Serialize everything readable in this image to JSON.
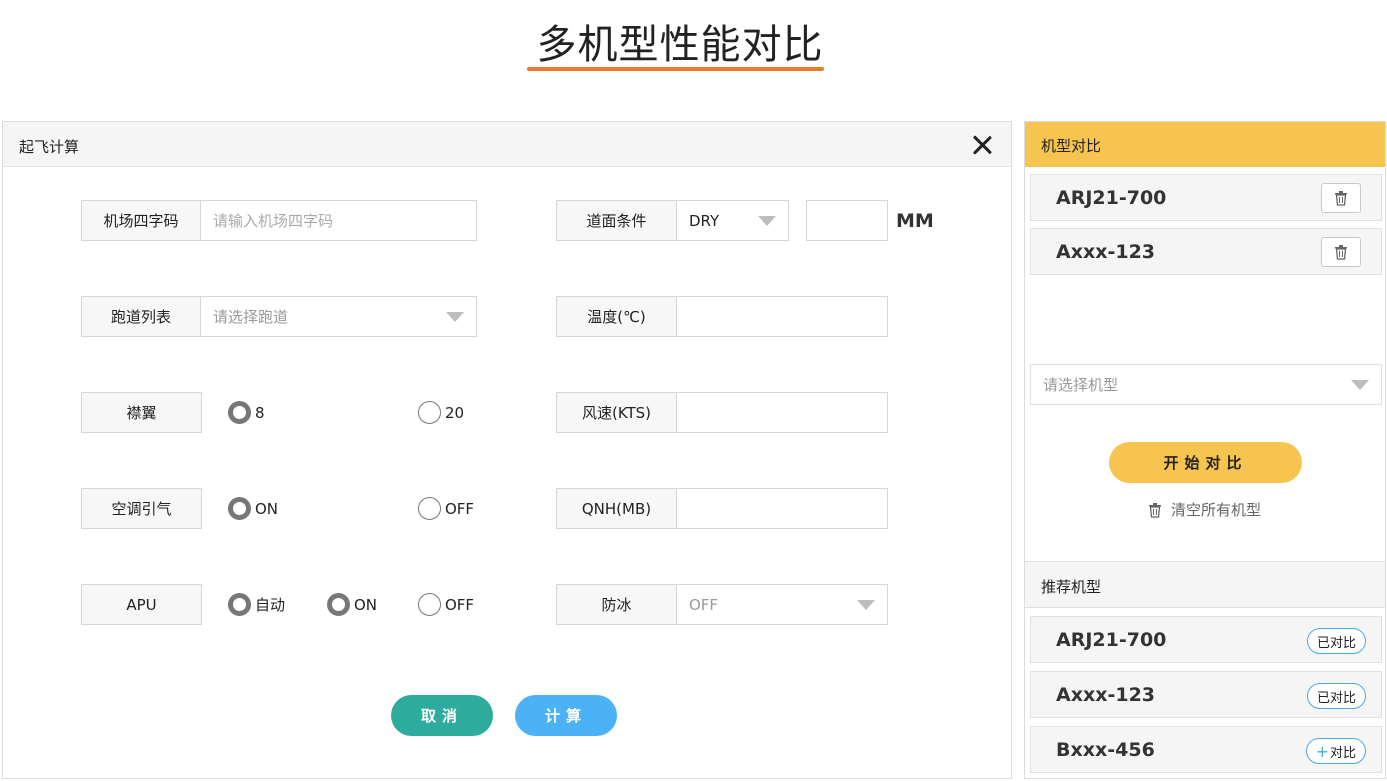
{
  "page": {
    "title": "多机型性能对比"
  },
  "form": {
    "header_title": "起飞计算",
    "airport": {
      "label": "机场四字码",
      "placeholder": "请输入机场四字码"
    },
    "runway_condition": {
      "label": "道面条件",
      "value": "DRY",
      "unit": "MM"
    },
    "runway_list": {
      "label": "跑道列表",
      "placeholder": "请选择跑道"
    },
    "temperature": {
      "label": "温度(℃)"
    },
    "flaps": {
      "label": "襟翼",
      "options": [
        "8",
        "20"
      ],
      "selected": "8"
    },
    "wind": {
      "label": "风速(KTS)"
    },
    "bleed": {
      "label": "空调引气",
      "options": [
        "ON",
        "OFF"
      ],
      "selected": "ON"
    },
    "qnh": {
      "label": "QNH(MB)"
    },
    "apu": {
      "label": "APU",
      "options": [
        "自动",
        "ON",
        "OFF"
      ],
      "selected": [
        "自动",
        "ON"
      ]
    },
    "anti_ice": {
      "label": "防冰",
      "value": "OFF"
    },
    "cancel_label": "取消",
    "calc_label": "计算"
  },
  "sidebar": {
    "compare_title": "机型对比",
    "compare_models": [
      "ARJ21-700",
      "Axxx-123"
    ],
    "select_placeholder": "请选择机型",
    "start_label": "开始对比",
    "clear_label": "清空所有机型",
    "recommend_title": "推荐机型",
    "recommend": [
      {
        "name": "ARJ21-700",
        "action": "已对比"
      },
      {
        "name": "Axxx-123",
        "action": "已对比"
      },
      {
        "name": "Bxxx-456",
        "action": "对比",
        "plus": "+"
      }
    ]
  },
  "colors": {
    "accent_orange": "#ee7a2e",
    "yellow": "#f7c44f",
    "teal": "#2dab9c",
    "blue": "#4bb3f5"
  }
}
